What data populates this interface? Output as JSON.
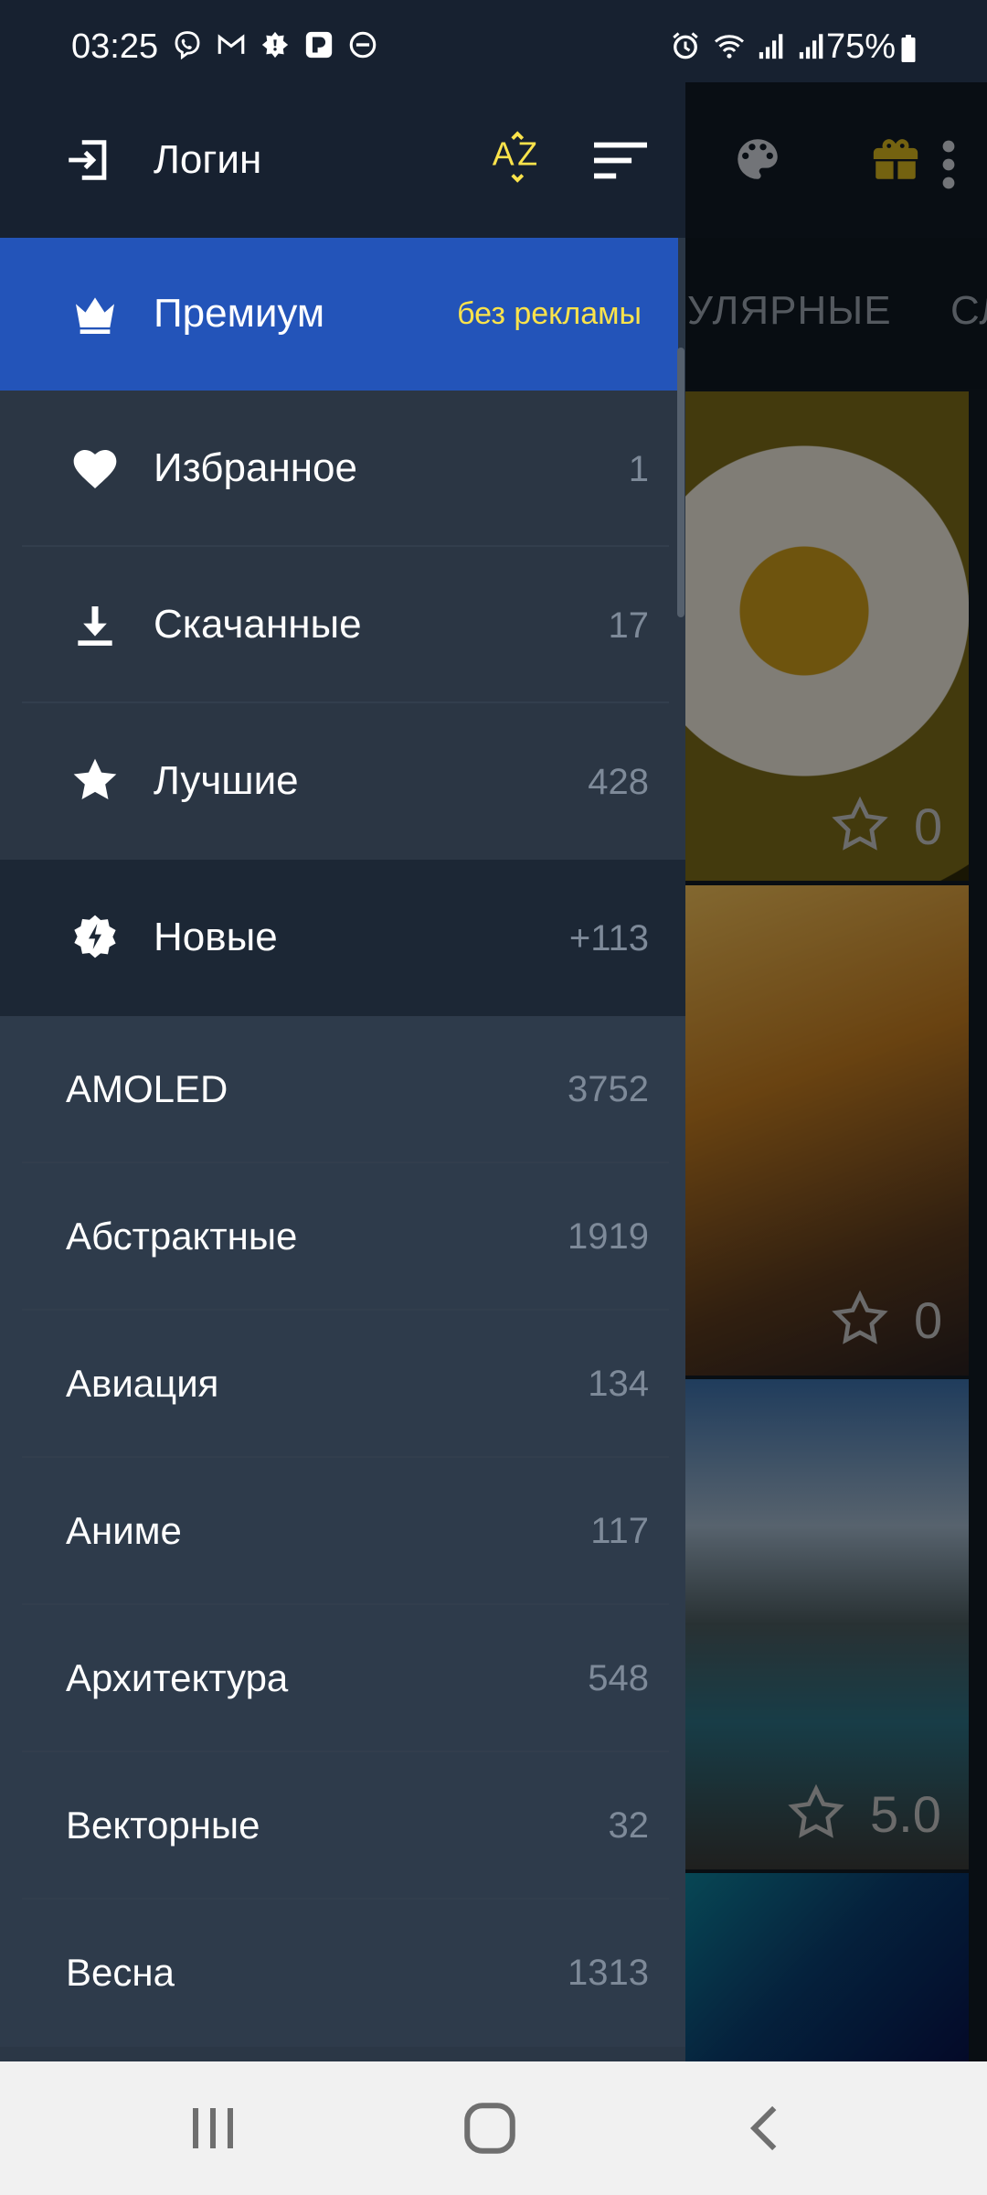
{
  "status_bar": {
    "time": "03:25",
    "battery": "75%",
    "left_icons": [
      "viber-icon",
      "gmail-icon",
      "badge-icon",
      "app-icon",
      "do-not-disturb-icon"
    ],
    "right_icons": [
      "alarm-icon",
      "wifi-icon",
      "signal-icon",
      "signal-icon"
    ]
  },
  "drawer": {
    "header": {
      "login_label": "Логин",
      "az_icon": "sort-az-icon",
      "sort_icon": "sort-list-icon"
    },
    "premium": {
      "label": "Премиум",
      "note": "без рекламы",
      "icon": "crown-icon",
      "color": "#2354b9"
    },
    "main_items": [
      {
        "label": "Избранное",
        "count": "1",
        "icon": "heart-icon"
      },
      {
        "label": "Скачанные",
        "count": "17",
        "icon": "download-icon"
      },
      {
        "label": "Лучшие",
        "count": "428",
        "icon": "star-icon"
      },
      {
        "label": "Новые",
        "count": "+113",
        "icon": "new-badge-icon"
      }
    ],
    "categories": [
      {
        "label": "AMOLED",
        "count": "3752"
      },
      {
        "label": "Абстрактные",
        "count": "1919"
      },
      {
        "label": "Авиация",
        "count": "134"
      },
      {
        "label": "Аниме",
        "count": "117"
      },
      {
        "label": "Архитектура",
        "count": "548"
      },
      {
        "label": "Векторные",
        "count": "32"
      },
      {
        "label": "Весна",
        "count": "1313"
      }
    ]
  },
  "background": {
    "tabs": [
      "УЛЯРНЫЕ",
      "СЛ"
    ],
    "toolbar_icons": [
      "palette-icon",
      "gift-icon",
      "more-icon"
    ],
    "cards": [
      {
        "rating": "0"
      },
      {
        "rating": "0"
      },
      {
        "rating": "5.0"
      }
    ]
  },
  "colors": {
    "accent_yellow": "#fbe34b",
    "drawer_bg": "#2b3746",
    "header_bg": "#172130"
  }
}
